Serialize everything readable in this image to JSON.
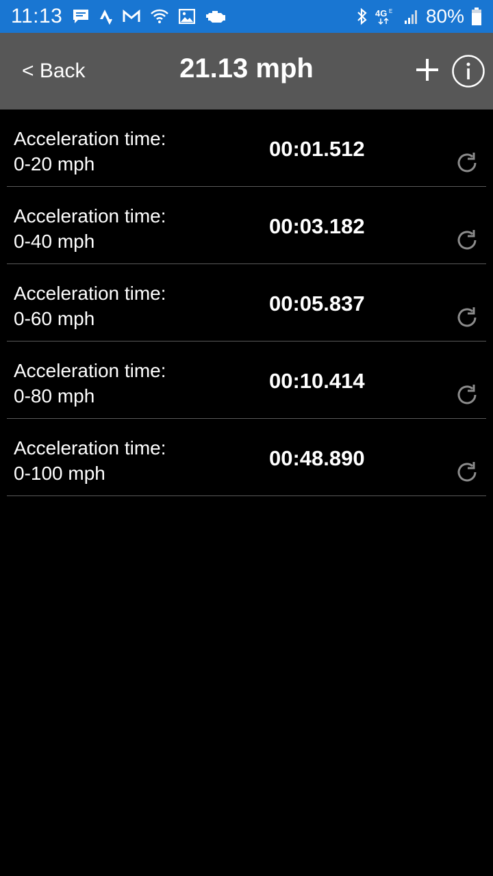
{
  "status_bar": {
    "time": "11:13",
    "battery": "80%",
    "background": "#1976d2",
    "left_icons": [
      "message-icon",
      "strava-icon",
      "gmail-icon",
      "wifi-icon",
      "image-icon",
      "engine-icon"
    ],
    "right_icons": [
      "bluetooth-icon",
      "lte-icon",
      "signal-icon",
      "battery-icon"
    ]
  },
  "header": {
    "back_label": "< Back",
    "title": "21.13 mph",
    "background": "#575757",
    "add_icon": "plus-icon",
    "info_icon": "info-icon"
  },
  "results": [
    {
      "label_line1": "Acceleration time:",
      "label_line2": "0-20 mph",
      "time": "00:01.512"
    },
    {
      "label_line1": "Acceleration time:",
      "label_line2": "0-40 mph",
      "time": "00:03.182"
    },
    {
      "label_line1": "Acceleration time:",
      "label_line2": "0-60 mph",
      "time": "00:05.837"
    },
    {
      "label_line1": "Acceleration time:",
      "label_line2": "0-80 mph",
      "time": "00:10.414"
    },
    {
      "label_line1": "Acceleration time:",
      "label_line2": "0-100 mph",
      "time": "00:48.890"
    }
  ],
  "row_action_icon": "refresh-icon"
}
